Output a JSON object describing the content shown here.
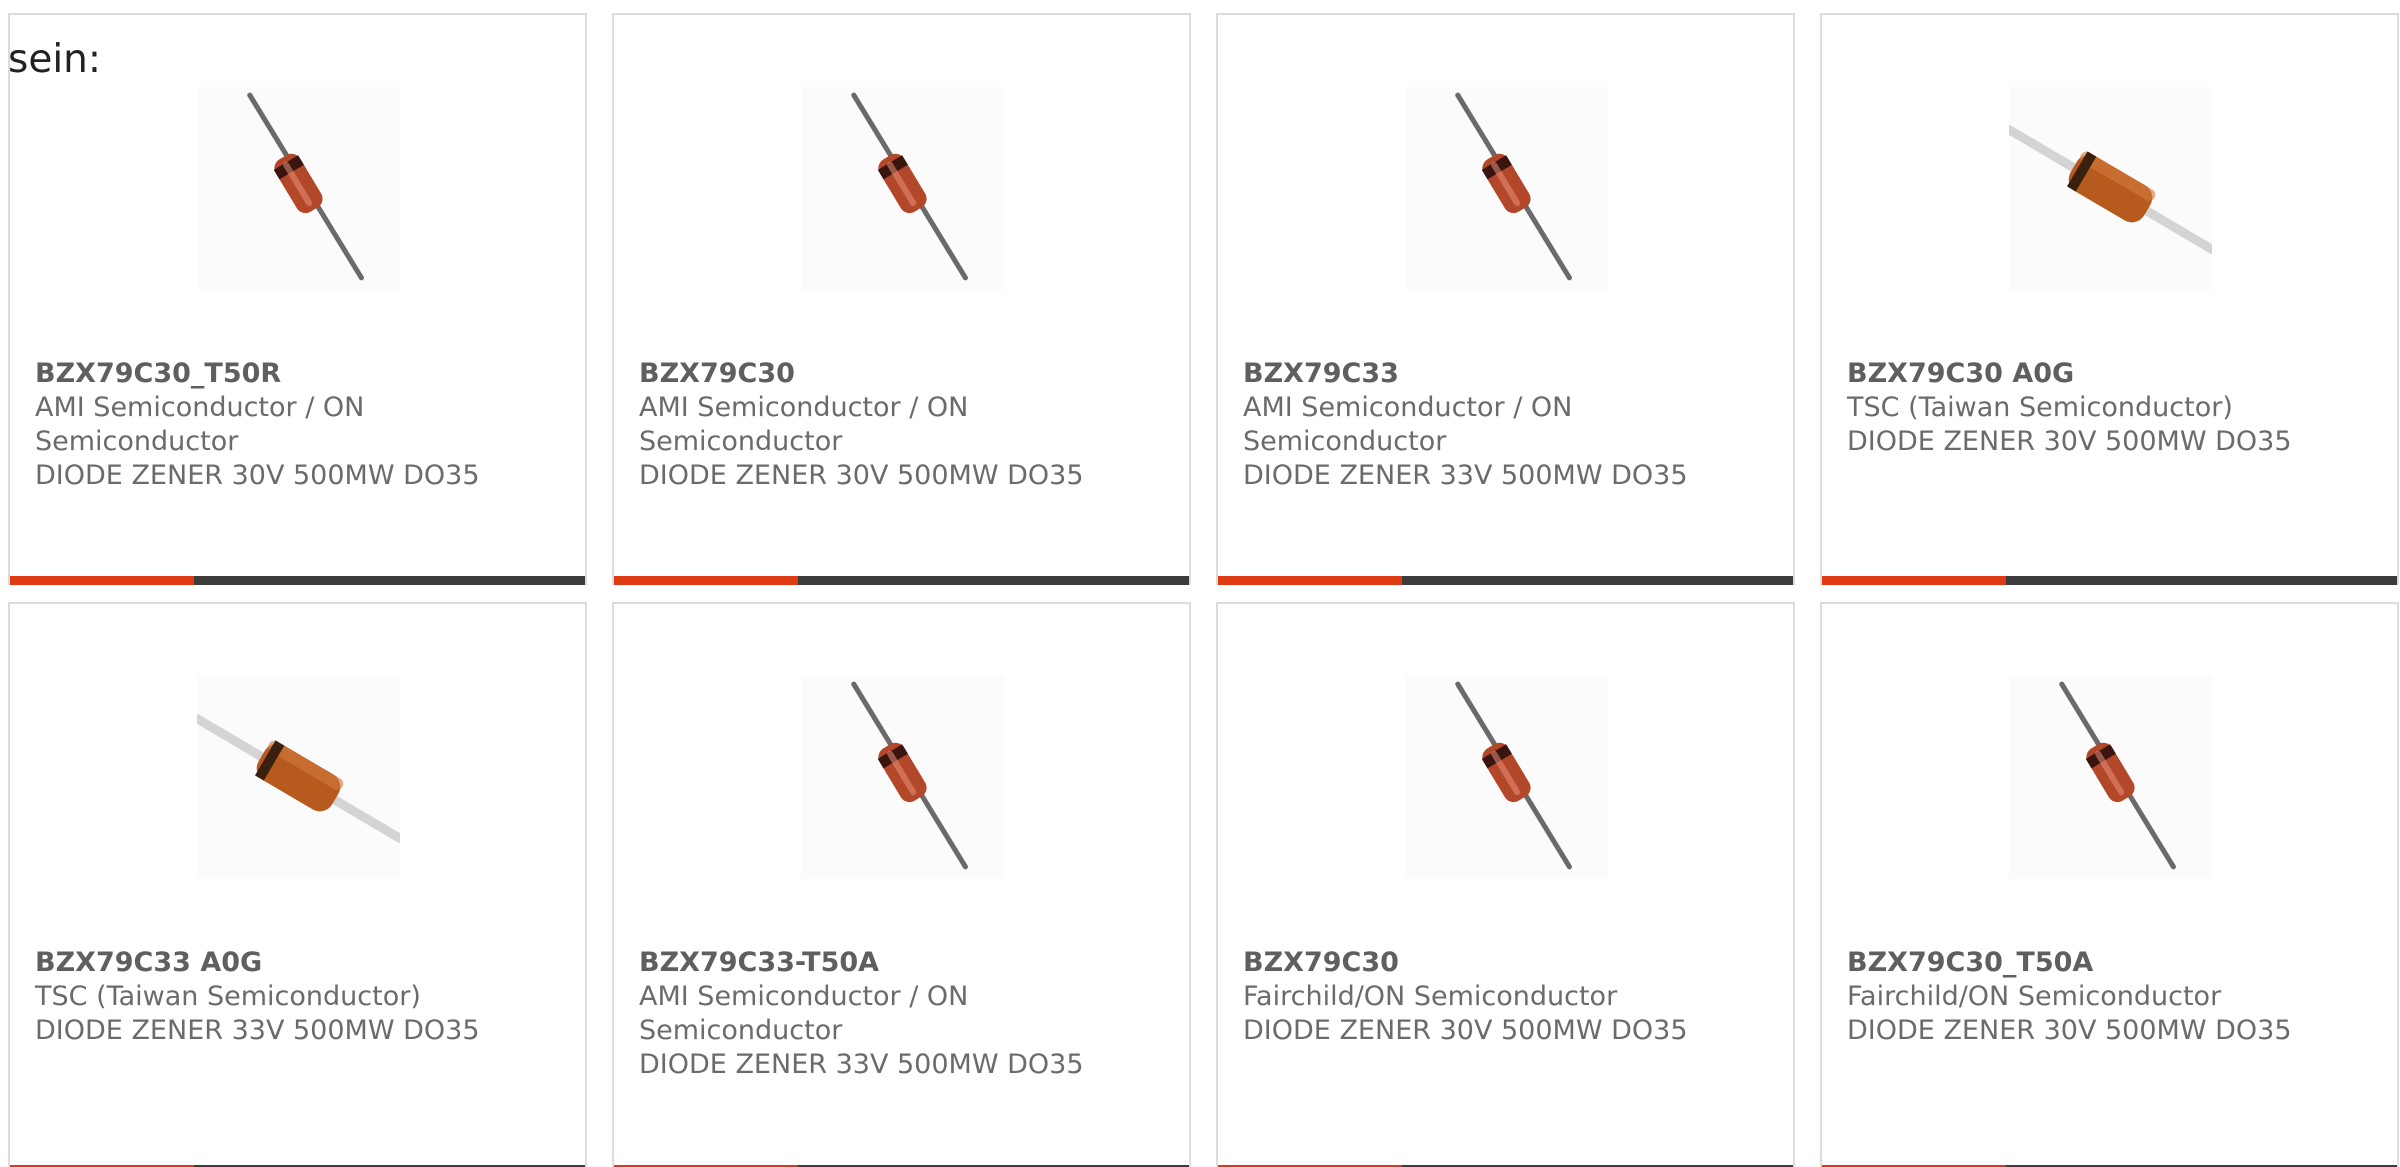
{
  "intro_text": "sein:",
  "accent_color": "#e03a14",
  "bar_color": "#3b3b3b",
  "cards": [
    {
      "part": "BZX79C30_T50R",
      "maker": "AMI Semiconductor / ON Semiconductor",
      "desc": "DIODE ZENER 30V 500MW DO35",
      "image_icon": "axial-zener-diode-glass-icon"
    },
    {
      "part": "BZX79C30",
      "maker": "AMI Semiconductor / ON Semiconductor",
      "desc": "DIODE ZENER 30V 500MW DO35",
      "image_icon": "axial-zener-diode-glass-icon"
    },
    {
      "part": "BZX79C33",
      "maker": "AMI Semiconductor / ON Semiconductor",
      "desc": "DIODE ZENER 33V 500MW DO35",
      "image_icon": "axial-zener-diode-glass-icon"
    },
    {
      "part": "BZX79C30 A0G",
      "maker": "TSC (Taiwan Semiconductor)",
      "desc": "DIODE ZENER 30V 500MW DO35",
      "image_icon": "axial-diode-brown-icon"
    },
    {
      "part": "BZX79C33 A0G",
      "maker": "TSC (Taiwan Semiconductor)",
      "desc": "DIODE ZENER 33V 500MW DO35",
      "image_icon": "axial-diode-brown-icon"
    },
    {
      "part": "BZX79C33-T50A",
      "maker": "AMI Semiconductor / ON Semiconductor",
      "desc": "DIODE ZENER 33V 500MW DO35",
      "image_icon": "axial-zener-diode-glass-icon"
    },
    {
      "part": "BZX79C30",
      "maker": "Fairchild/ON Semiconductor",
      "desc": "DIODE ZENER 30V 500MW DO35",
      "image_icon": "axial-zener-diode-glass-icon"
    },
    {
      "part": "BZX79C30_T50A",
      "maker": "Fairchild/ON Semiconductor",
      "desc": "DIODE ZENER 30V 500MW DO35",
      "image_icon": "axial-zener-diode-glass-icon"
    }
  ]
}
